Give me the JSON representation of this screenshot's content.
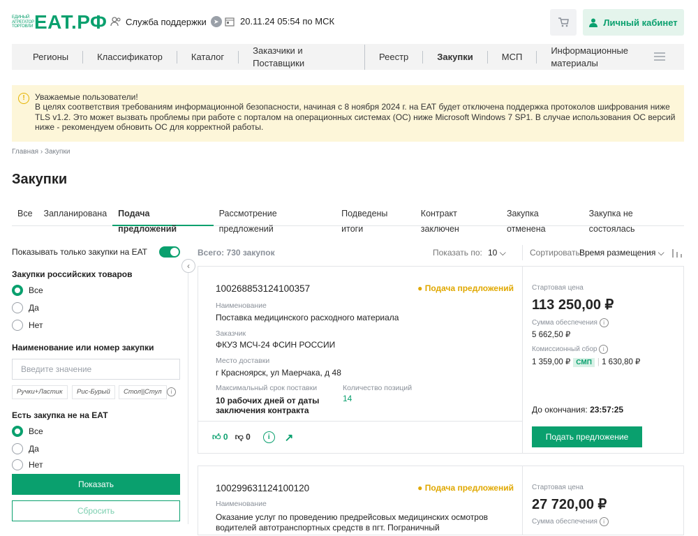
{
  "header": {
    "logo_small": "Единый агрегатор торговли",
    "logo_big": "ЕАТ.РФ",
    "support": "Служба поддержки",
    "datetime": "20.11.24 05:54 по МСК",
    "cabinet": "Личный кабинет"
  },
  "nav": [
    "Регионы",
    "Классификатор",
    "Каталог",
    "Заказчики и Поставщики",
    "Реестр",
    "Закупки",
    "МСП",
    "Информационные материалы"
  ],
  "alert": {
    "line1": "Уважаемые пользователи!",
    "body": "В целях соответствия требованиям информационной безопасности, начиная с 8 ноября 2024 г. на ЕАТ будет отключена поддержка протоколов шифрования ниже TLS v1.2. Это может вызвать проблемы при работе с порталом на операционных системах (ОС) ниже Microsoft Windows 7 SP1. В случае использования ОС версий ниже - рекомендуем обновить ОС для корректной работы."
  },
  "breadcrumb": "Главная › Закупки",
  "page_title": "Закупки",
  "tabs": [
    "Все",
    "Запланирована",
    "Подача предложений",
    "Рассмотрение предложений",
    "Подведены итоги",
    "Контракт заключен",
    "Закупка отменена",
    "Закупка не состоялась"
  ],
  "filters": {
    "only_eat": "Показывать только закупки на ЕАТ",
    "russian_goods": "Закупки российских товаров",
    "opt_all": "Все",
    "opt_yes": "Да",
    "opt_no": "Нет",
    "name_label": "Наименование или номер закупки",
    "name_placeholder": "Введите значение",
    "chips": [
      "Ручки+Ластик",
      "Рис-Бурый",
      "Стол||Стул"
    ],
    "not_on_eat": "Есть закупка не на ЕАТ",
    "show": "Показать",
    "reset": "Сбросить"
  },
  "list": {
    "total": "Всего: 730 закупок",
    "per_page_label": "Показать по:",
    "per_page": "10",
    "sort_label": "Сортировать:",
    "sort_value": "Время размещения"
  },
  "cards": [
    {
      "number": "100268853124100357",
      "status": "● Подача предложений",
      "name_label": "Наименование",
      "name": "Поставка медицинского расходного материала",
      "customer_label": "Заказчик",
      "customer": "ФКУЗ МСЧ-24 ФСИН РОССИИ",
      "place_label": "Место доставки",
      "place": "г Красноярск, ул Маерчака, д 48",
      "term_label": "Максимальный срок поставки",
      "term": "10 рабочих дней от даты заключения контракта",
      "qty_label": "Количество позиций",
      "qty": "14",
      "likes": "0",
      "dislikes": "0",
      "start_label": "Стартовая цена",
      "start_price": "113 250,00 ₽",
      "deposit_label": "Сумма обеспечения",
      "deposit": "5 662,50 ₽",
      "fee_label": "Комиссионный сбор",
      "fee": "1 359,00 ₽",
      "smp": "СМП",
      "fee2": "1 630,80 ₽",
      "ends_label": "До окончания:",
      "ends": "23:57:25",
      "submit": "Подать предложение"
    },
    {
      "number": "100299631124100120",
      "status": "● Подача предложений",
      "name_label": "Наименование",
      "name": "Оказание услуг по проведению предрейсовых медицинских осмотров водителей автотранспортных средств в пгт. Пограничный",
      "start_label": "Стартовая цена",
      "start_price": "27 720,00 ₽",
      "deposit_label": "Сумма обеспечения"
    }
  ]
}
